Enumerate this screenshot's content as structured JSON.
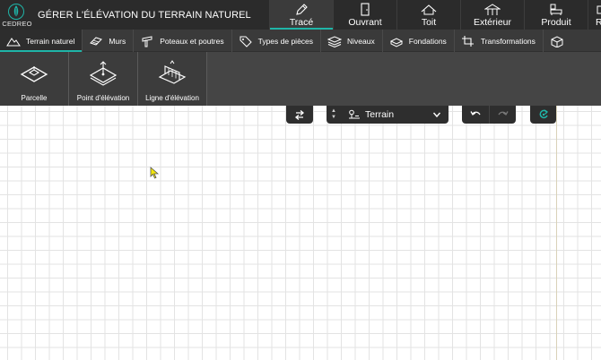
{
  "app": {
    "brand": "CEDREO",
    "page_title": "GÉRER L'ÉLÉVATION DU TERRAIN NATUREL"
  },
  "main_tabs": [
    {
      "label": "Tracé",
      "icon": "pencil-icon",
      "active": true
    },
    {
      "label": "Ouvrant",
      "icon": "door-icon",
      "active": false
    },
    {
      "label": "Toit",
      "icon": "roof-icon",
      "active": false
    },
    {
      "label": "Extérieur",
      "icon": "pergola-icon",
      "active": false
    },
    {
      "label": "Produit",
      "icon": "furniture-icon",
      "active": false
    },
    {
      "label": "R",
      "icon": "",
      "active": false
    }
  ],
  "sub_tabs": [
    {
      "label": "Terrain naturel",
      "icon": "mountain-icon",
      "active": true
    },
    {
      "label": "Murs",
      "icon": "brick-wall-icon",
      "active": false
    },
    {
      "label": "Poteaux et poutres",
      "icon": "beam-icon",
      "active": false
    },
    {
      "label": "Types de pièces",
      "icon": "tag-icon",
      "active": false
    },
    {
      "label": "Niveaux",
      "icon": "layers-icon",
      "active": false
    },
    {
      "label": "Fondations",
      "icon": "foundation-icon",
      "active": false
    },
    {
      "label": "Transformations",
      "icon": "crop-icon",
      "active": false
    },
    {
      "label": "",
      "icon": "cube-icon",
      "active": false
    }
  ],
  "tools": [
    {
      "label": "Parcelle",
      "icon": "parcel-icon"
    },
    {
      "label": "Point d'élévation",
      "icon": "elevation-point-icon"
    },
    {
      "label": "Ligne d'élévation",
      "icon": "elevation-line-icon"
    }
  ],
  "canvas_toolbar": {
    "layer_label": "Terrain",
    "swap_icon": "swap-icon",
    "undo_icon": "undo-icon",
    "redo_icon": "redo-icon",
    "action_icon": "refresh-icon"
  },
  "colors": {
    "accent": "#1fb5a8",
    "header_bg": "#2b2b2b",
    "subbar_bg": "#3a3a3a",
    "ribbon_bg": "#454545",
    "cursor": "#f2e60c"
  }
}
